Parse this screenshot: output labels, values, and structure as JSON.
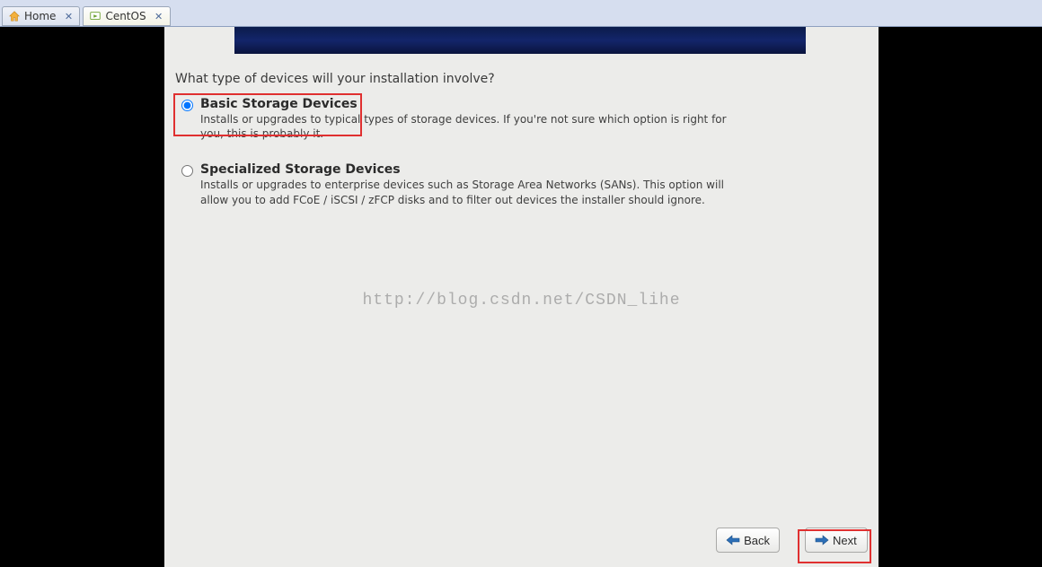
{
  "tabs": {
    "home": "Home",
    "centos": "CentOS"
  },
  "installer": {
    "question": "What type of devices will your installation involve?",
    "options": {
      "basic": {
        "title": "Basic Storage Devices",
        "desc": "Installs or upgrades to typical types of storage devices.  If you're not sure which option is right for you, this is probably it.",
        "selected": true
      },
      "specialized": {
        "title": "Specialized Storage Devices",
        "desc": "Installs or upgrades to enterprise devices such as Storage Area Networks (SANs). This option will allow you to add FCoE / iSCSI / zFCP disks and to filter out devices the installer should ignore.",
        "selected": false
      }
    },
    "buttons": {
      "back": "Back",
      "next": "Next"
    }
  },
  "watermark": "http://blog.csdn.net/CSDN_lihe"
}
